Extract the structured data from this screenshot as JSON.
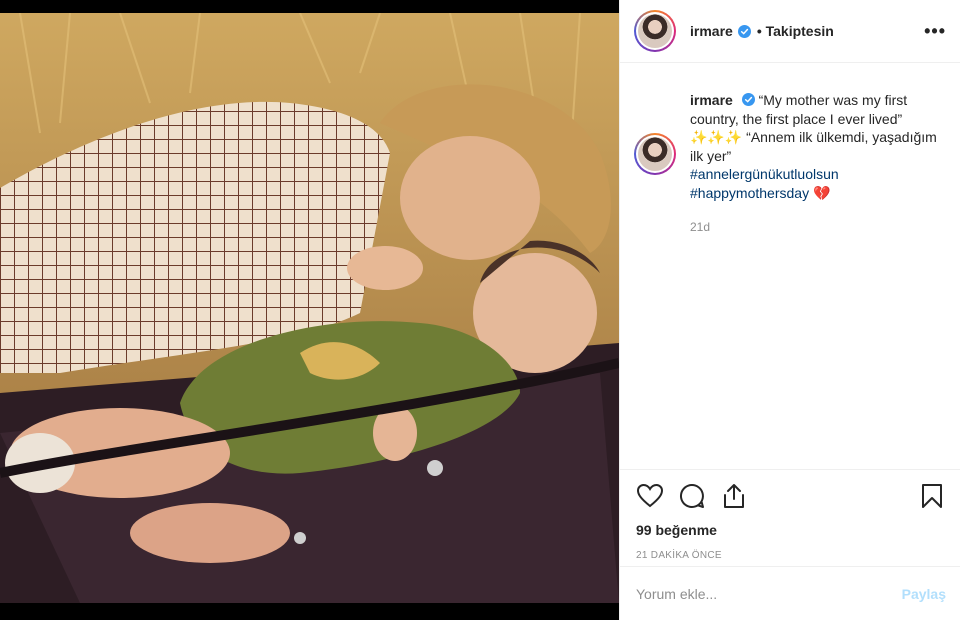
{
  "post": {
    "username": "irmare",
    "verified": true,
    "follow_label": "• Takiptesin",
    "more_icon": "more-horizontal-icon"
  },
  "caption": {
    "username": "irmare",
    "line1": "“My mother was my first country, the first place I ever lived”",
    "sparkles": "✨✨✨",
    "line2": " “Annem ilk ülkemdi, yaşadığım ilk yer”",
    "hashtag1": "#annelergünükutluolsun",
    "hashtag2": "#happymothersday",
    "heart": "💔",
    "time_ago": "21d"
  },
  "actions": {
    "like_icon": "heart-icon",
    "comment_icon": "comment-icon",
    "share_icon": "share-icon",
    "save_icon": "bookmark-icon",
    "likes_text": "99 beğenme",
    "date_text": "21 DAKİKA ÖNCE"
  },
  "comment_box": {
    "placeholder": "Yorum ekle...",
    "post_label": "Paylaş"
  },
  "colors": {
    "verified": "#3897f0",
    "hashtag": "#00376b",
    "muted": "#8e8e8e",
    "post_button": "#b2dffc"
  }
}
